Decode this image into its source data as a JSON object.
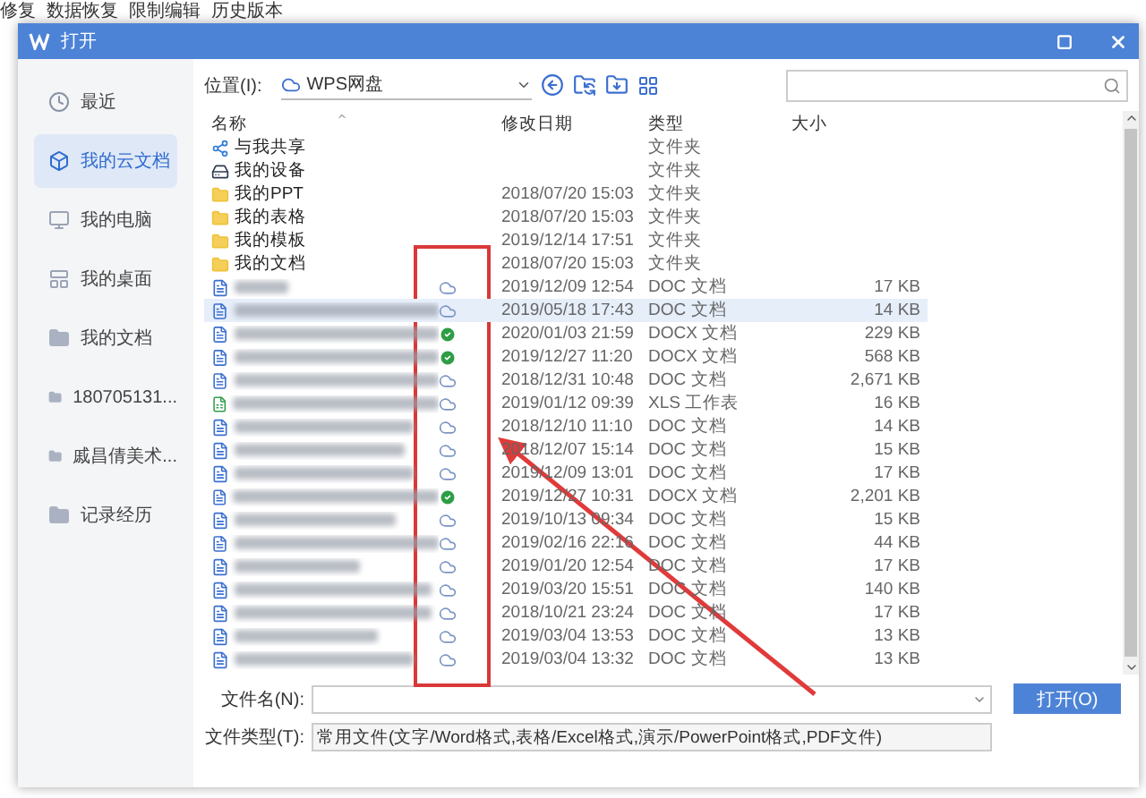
{
  "background_menu": [
    "修复",
    "数据恢复",
    "限制编辑",
    "历史版本"
  ],
  "window": {
    "title": "打开"
  },
  "sidebar": {
    "items": [
      {
        "label": "最近",
        "kind": "recent",
        "selected": false
      },
      {
        "label": "我的云文档",
        "kind": "cloud",
        "selected": true
      },
      {
        "label": "我的电脑",
        "kind": "computer",
        "selected": false
      },
      {
        "label": "我的桌面",
        "kind": "desktop",
        "selected": false
      },
      {
        "label": "我的文档",
        "kind": "folder",
        "selected": false
      },
      {
        "label": "180705131...",
        "kind": "folder",
        "selected": false
      },
      {
        "label": "戚昌倩美术...",
        "kind": "folder",
        "selected": false
      },
      {
        "label": "记录经历",
        "kind": "folder",
        "selected": false
      }
    ]
  },
  "location": {
    "label": "位置(I):",
    "value": "WPS网盘"
  },
  "table": {
    "columns": [
      "名称",
      "修改日期",
      "类型",
      "大小"
    ],
    "rows": [
      {
        "kind": "share",
        "name": "与我共享",
        "type": "文件夹",
        "selected": false
      },
      {
        "kind": "device",
        "name": "我的设备",
        "type": "文件夹",
        "selected": false
      },
      {
        "kind": "folder",
        "name": "我的PPT",
        "date": "2018/07/20 15:03",
        "type": "文件夹",
        "selected": false
      },
      {
        "kind": "folder",
        "name": "我的表格",
        "date": "2018/07/20 15:03",
        "type": "文件夹",
        "selected": false
      },
      {
        "kind": "folder",
        "name": "我的模板",
        "date": "2019/12/14 17:51",
        "type": "文件夹",
        "selected": false
      },
      {
        "kind": "folder",
        "name": "我的文档",
        "date": "2018/07/20 15:03",
        "type": "文件夹",
        "selected": false
      },
      {
        "kind": "doc",
        "synced": false,
        "date": "2019/12/09 12:54",
        "type": "DOC 文档",
        "size": "17 KB",
        "selected": false
      },
      {
        "kind": "doc",
        "synced": false,
        "date": "2019/05/18 17:43",
        "type": "DOC 文档",
        "size": "14 KB",
        "selected": true
      },
      {
        "kind": "doc",
        "synced": true,
        "date": "2020/01/03 21:59",
        "type": "DOCX 文档",
        "size": "229 KB",
        "selected": false
      },
      {
        "kind": "doc",
        "synced": true,
        "date": "2019/12/27 11:20",
        "type": "DOCX 文档",
        "size": "568 KB",
        "selected": false
      },
      {
        "kind": "doc",
        "synced": false,
        "date": "2018/12/31 10:48",
        "type": "DOC 文档",
        "size": "2,671 KB",
        "selected": false
      },
      {
        "kind": "xls",
        "synced": false,
        "date": "2019/01/12 09:39",
        "type": "XLS 工作表",
        "size": "16 KB",
        "selected": false
      },
      {
        "kind": "doc",
        "synced": false,
        "date": "2018/12/10 11:10",
        "type": "DOC 文档",
        "size": "14 KB",
        "selected": false
      },
      {
        "kind": "doc",
        "synced": false,
        "date": "2018/12/07 15:14",
        "type": "DOC 文档",
        "size": "15 KB",
        "selected": false
      },
      {
        "kind": "doc",
        "synced": false,
        "date": "2019/12/09 13:01",
        "type": "DOC 文档",
        "size": "17 KB",
        "selected": false
      },
      {
        "kind": "doc",
        "synced": true,
        "date": "2019/12/27 10:31",
        "type": "DOCX 文档",
        "size": "2,201 KB",
        "selected": false
      },
      {
        "kind": "doc",
        "synced": false,
        "date": "2019/10/13 09:34",
        "type": "DOC 文档",
        "size": "15 KB",
        "selected": false
      },
      {
        "kind": "doc",
        "synced": false,
        "date": "2019/02/16 22:16",
        "type": "DOC 文档",
        "size": "44 KB",
        "selected": false
      },
      {
        "kind": "doc",
        "synced": false,
        "date": "2019/01/20 12:54",
        "type": "DOC 文档",
        "size": "17 KB",
        "selected": false
      },
      {
        "kind": "doc",
        "synced": false,
        "date": "2019/03/20 15:51",
        "type": "DOC 文档",
        "size": "140 KB",
        "selected": false
      },
      {
        "kind": "doc",
        "synced": false,
        "date": "2018/10/21 23:24",
        "type": "DOC 文档",
        "size": "17 KB",
        "selected": false
      },
      {
        "kind": "doc",
        "synced": false,
        "date": "2019/03/04 13:53",
        "type": "DOC 文档",
        "size": "13 KB",
        "selected": false
      },
      {
        "kind": "doc",
        "synced": false,
        "date": "2019/03/04 13:32",
        "type": "DOC 文档",
        "size": "13 KB",
        "selected": false
      }
    ]
  },
  "file_name": {
    "label": "文件名(N):"
  },
  "file_type": {
    "label": "文件类型(T):",
    "value": "常用文件(文字/Word格式,表格/Excel格式,演示/PowerPoint格式,PDF文件)"
  },
  "open_button": "打开(O)"
}
